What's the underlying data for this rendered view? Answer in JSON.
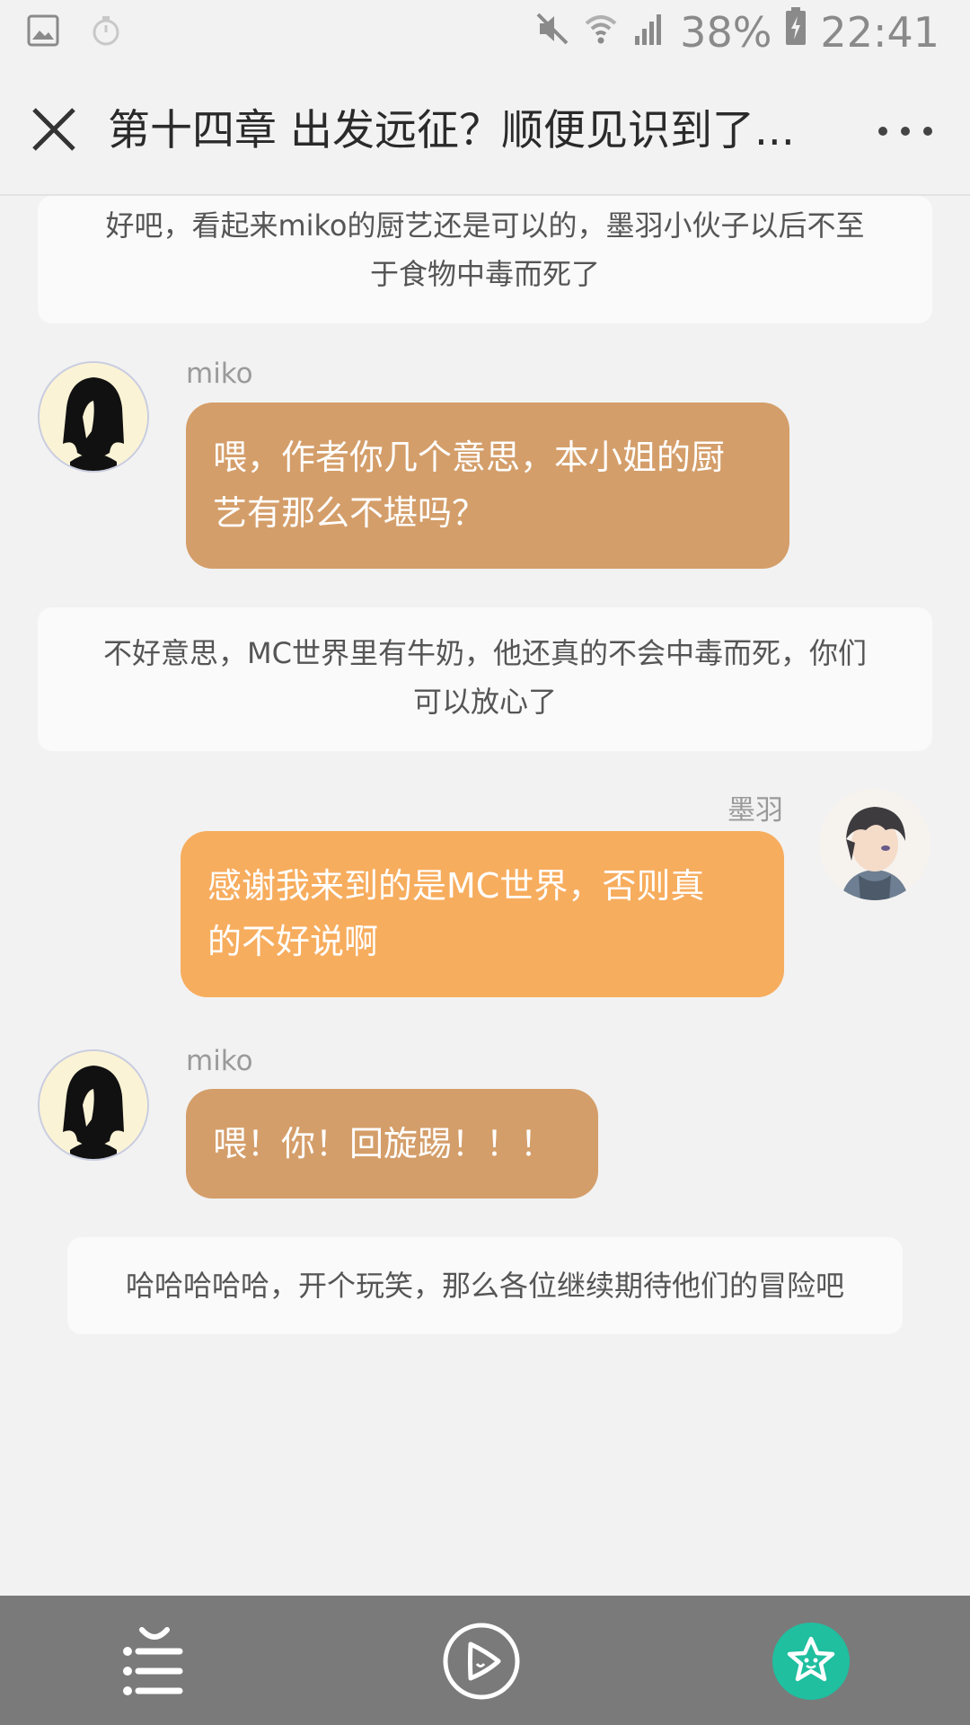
{
  "status": {
    "battery": "38%",
    "time": "22:41",
    "icons": [
      "image-icon",
      "timer-icon",
      "mute-icon",
      "wifi-icon",
      "signal-icon",
      "battery-charging-icon"
    ]
  },
  "header": {
    "title": "第十四章 出发远征？顺便见识到了..."
  },
  "messages": {
    "narr1": [
      "好吧，看起来miko的厨艺还是可以的，墨羽小伙子以后不至",
      "于食物中毒而死了"
    ],
    "miko1_name": "miko",
    "miko1_text": [
      "喂，作者你几个意思，本小姐的厨",
      "艺有那么不堪吗？"
    ],
    "narr2": [
      "不好意思，MC世界里有牛奶，他还真的不会中毒而死，你们",
      "可以放心了"
    ],
    "moyu1_name": "墨羽",
    "moyu1_text": [
      "感谢我来到的是MC世界，否则真",
      "的不好说啊"
    ],
    "miko2_name": "miko",
    "miko2_text": "喂！你！回旋踢！！！",
    "narr3": "哈哈哈哈哈，开个玩笑，那么各位继续期待他们的冒险吧"
  },
  "colors": {
    "miko_bubble": "#d49e6a",
    "moyu_bubble": "#f7ad5e",
    "bottom_bar": "#7a7a7a",
    "star_button": "#1fbf9f"
  },
  "bottombar": {
    "icons": [
      "chapter-list-icon",
      "autoplay-icon",
      "star-favorite-icon"
    ]
  }
}
